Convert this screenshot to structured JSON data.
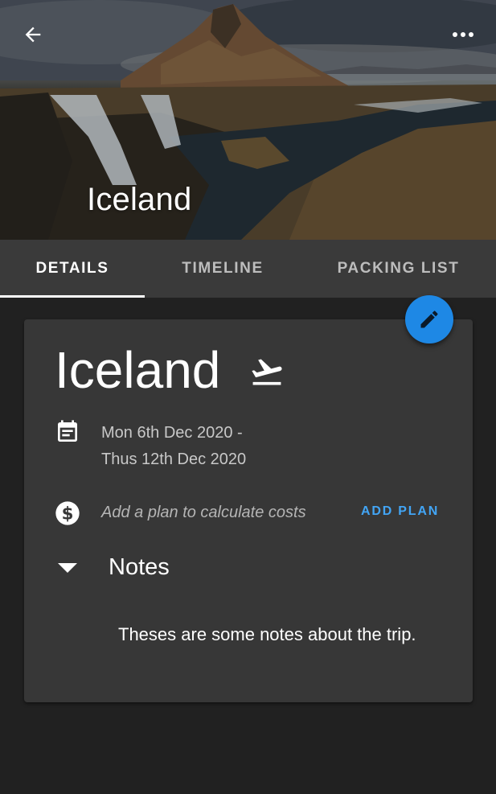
{
  "header": {
    "title": "Iceland",
    "back_icon": "arrow-left-icon",
    "more_icon": "more-horizontal-icon"
  },
  "tabs": [
    {
      "label": "DETAILS",
      "selected": true
    },
    {
      "label": "TIMELINE",
      "selected": false
    },
    {
      "label": "PACKING LIST",
      "selected": false
    }
  ],
  "trip": {
    "title": "Iceland",
    "type_icon": "flight-takeoff-icon",
    "date_icon": "calendar-icon",
    "date_line1": "Mon 6th Dec 2020 -",
    "date_line2": "Thus 12th Dec 2020",
    "cost_icon": "dollar-circle-icon",
    "cost_text": "Add a plan to calculate costs",
    "add_plan_label": "ADD PLAN",
    "edit_icon": "pencil-icon"
  },
  "notes": {
    "label": "Notes",
    "expanded": true,
    "body": "Theses are some notes about the trip."
  },
  "colors": {
    "background": "#212121",
    "tab_bar": "#3a3a3a",
    "card": "#373737",
    "accent": "#1e88e5",
    "link": "#42a5f5"
  }
}
